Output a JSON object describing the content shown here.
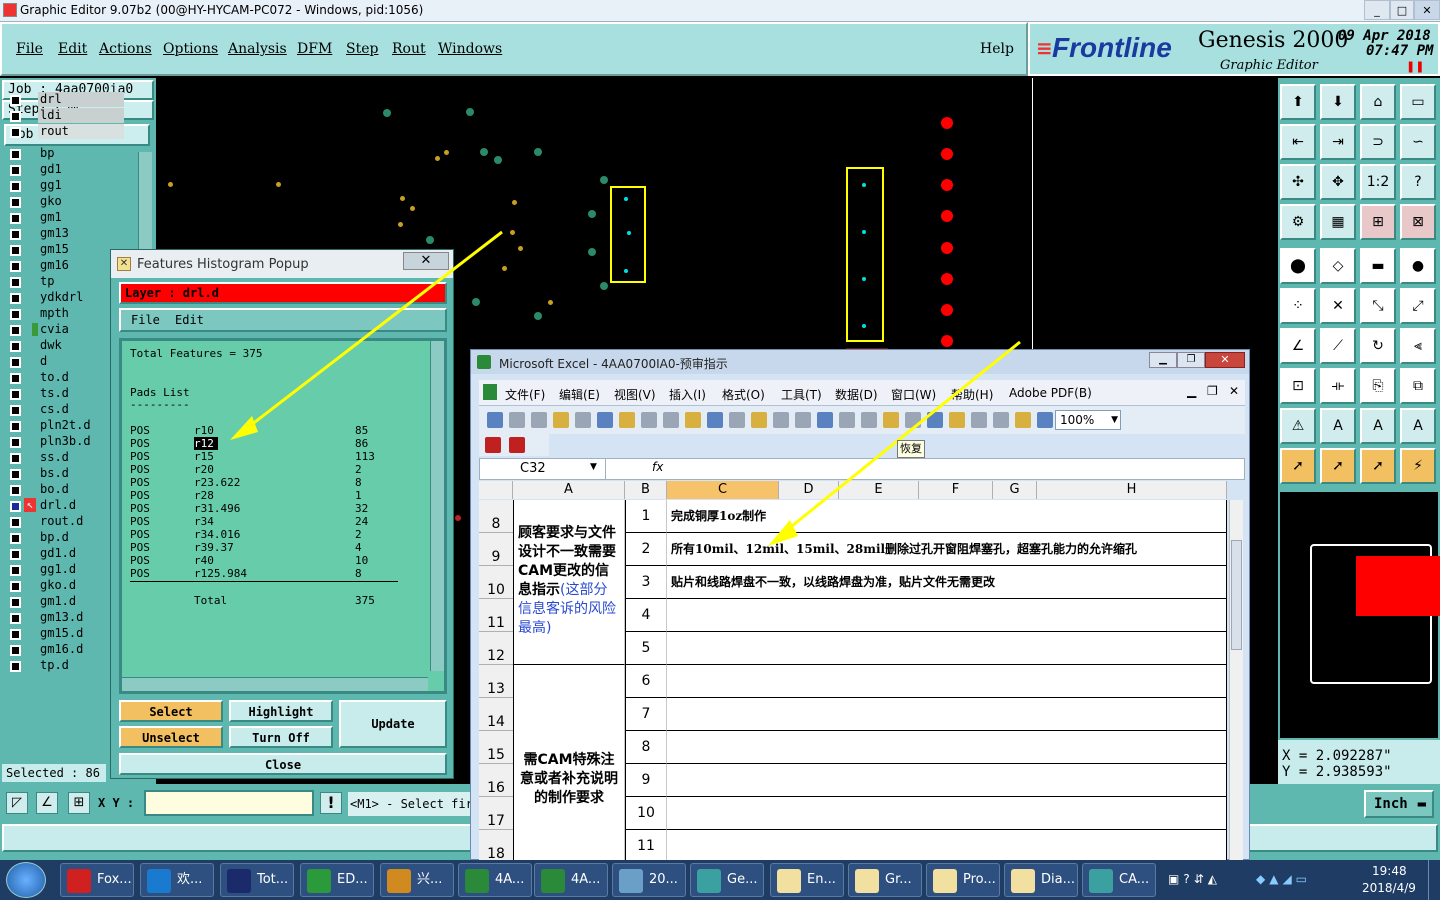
{
  "title_bar": {
    "title": "Graphic Editor 9.07b2 (00@HY-HYCAM-PC072 - Windows, pid:1056)"
  },
  "menu": {
    "items": [
      "File",
      "Edit",
      "Actions",
      "Options",
      "Analysis",
      "DFM",
      "Step",
      "Rout",
      "Windows"
    ],
    "help": "Help"
  },
  "brand": {
    "logo": "Frontline",
    "product": "Genesis 2000",
    "subtitle": "Graphic Editor",
    "date": "09 Apr 2018",
    "time": "07:47 PM"
  },
  "job": {
    "job_label": "Job  : 4aa0700ia0",
    "step_label": "Step: cam",
    "matrix_button": "Job Matrix ..."
  },
  "layers": [
    "drl",
    "ldi",
    "rout",
    "bp",
    "gd1",
    "gg1",
    "gko",
    "gm1",
    "gm13",
    "gm15",
    "gm16",
    "tp",
    "ydkdrl",
    "mpth",
    "cvia",
    "dwk",
    "d",
    "to.d",
    "ts.d",
    "cs.d",
    "pln2t.d",
    "pln3b.d",
    "ss.d",
    "bs.d",
    "bo.d",
    "drl.d",
    "rout.d",
    "bp.d",
    "gd1.d",
    "gg1.d",
    "gko.d",
    "gm1.d",
    "gm13.d",
    "gm15.d",
    "gm16.d",
    "tp.d"
  ],
  "selected_label": "Selected : 86",
  "status": {
    "xy_label": "X Y :",
    "prompt": "<M1> - Select fir",
    "units": "Inch"
  },
  "coords": {
    "x": "X = 2.092287\"",
    "y": "Y = 2.938593\""
  },
  "popup": {
    "title": "Features Histogram Popup",
    "layer": "Layer  : drl.d",
    "menu": [
      "File",
      "Edit"
    ],
    "total_features": "Total Features = 375",
    "pads_list": "Pads List",
    "divider": "---------",
    "rows": [
      {
        "type": "POS",
        "sym": "r10",
        "count": "85"
      },
      {
        "type": "POS",
        "sym": "r12",
        "count": "86"
      },
      {
        "type": "POS",
        "sym": "r15",
        "count": "113"
      },
      {
        "type": "POS",
        "sym": "r20",
        "count": "2"
      },
      {
        "type": "POS",
        "sym": "r23.622",
        "count": "8"
      },
      {
        "type": "POS",
        "sym": "r28",
        "count": "1"
      },
      {
        "type": "POS",
        "sym": "r31.496",
        "count": "32"
      },
      {
        "type": "POS",
        "sym": "r34",
        "count": "24"
      },
      {
        "type": "POS",
        "sym": "r34.016",
        "count": "2"
      },
      {
        "type": "POS",
        "sym": "r39.37",
        "count": "4"
      },
      {
        "type": "POS",
        "sym": "r40",
        "count": "10"
      },
      {
        "type": "POS",
        "sym": "r125.984",
        "count": "8"
      }
    ],
    "total_label": "Total",
    "total_value": "375",
    "buttons": {
      "select": "Select",
      "highlight": "Highlight",
      "update": "Update",
      "unselect": "Unselect",
      "turn_off": "Turn Off",
      "close": "Close"
    }
  },
  "excel": {
    "title": "Microsoft Excel - 4AA0700IA0-预审指示",
    "menu": [
      "文件(F)",
      "编辑(E)",
      "视图(V)",
      "插入(I)",
      "格式(O)",
      "工具(T)",
      "数据(D)",
      "窗口(W)",
      "帮助(H)",
      "Adobe PDF(B)"
    ],
    "zoom": "100%",
    "tooltip": "恢复",
    "cell_ref": "C32",
    "fx": "fx",
    "columns": [
      "A",
      "B",
      "C",
      "D",
      "E",
      "F",
      "G",
      "H"
    ],
    "row_numbers": [
      "8",
      "9",
      "10",
      "11",
      "12",
      "13",
      "14",
      "15",
      "16",
      "17",
      "18"
    ],
    "block1_black": "顾客要求与文件设计不一致需要CAM更改的信息指示",
    "block1_blue": "(这部分信息客诉的风险最高)",
    "block2": "需CAM特殊注意或者补充说明的制作要求",
    "items": [
      {
        "n": "1",
        "text": "完成铜厚1oz制作"
      },
      {
        "n": "2",
        "text": "所有10mil、12mil、15mil、28mil删除过孔开窗阻焊塞孔，超塞孔能力的允许缩孔"
      },
      {
        "n": "3",
        "text": "贴片和线路焊盘不一致，以线路焊盘为准，贴片文件无需更改"
      },
      {
        "n": "4",
        "text": ""
      },
      {
        "n": "5",
        "text": ""
      },
      {
        "n": "6",
        "text": ""
      },
      {
        "n": "7",
        "text": ""
      },
      {
        "n": "8",
        "text": ""
      },
      {
        "n": "9",
        "text": ""
      },
      {
        "n": "10",
        "text": ""
      },
      {
        "n": "11",
        "text": ""
      }
    ]
  },
  "taskbar": {
    "tasks": [
      "Fox...",
      "欢...",
      "Tot...",
      "ED...",
      "兴...",
      "4A...",
      "4A...",
      "20...",
      "Ge...",
      "En...",
      "Gr...",
      "Pro...",
      "Dia...",
      "CA..."
    ],
    "time": "19:48",
    "date": "2018/4/9"
  },
  "colors": {
    "teal": "#5fb8b0",
    "red": "#ff0000",
    "yellow": "#ffff00",
    "popup_green": "#66ccaa",
    "button_orange": "#f2c060"
  }
}
